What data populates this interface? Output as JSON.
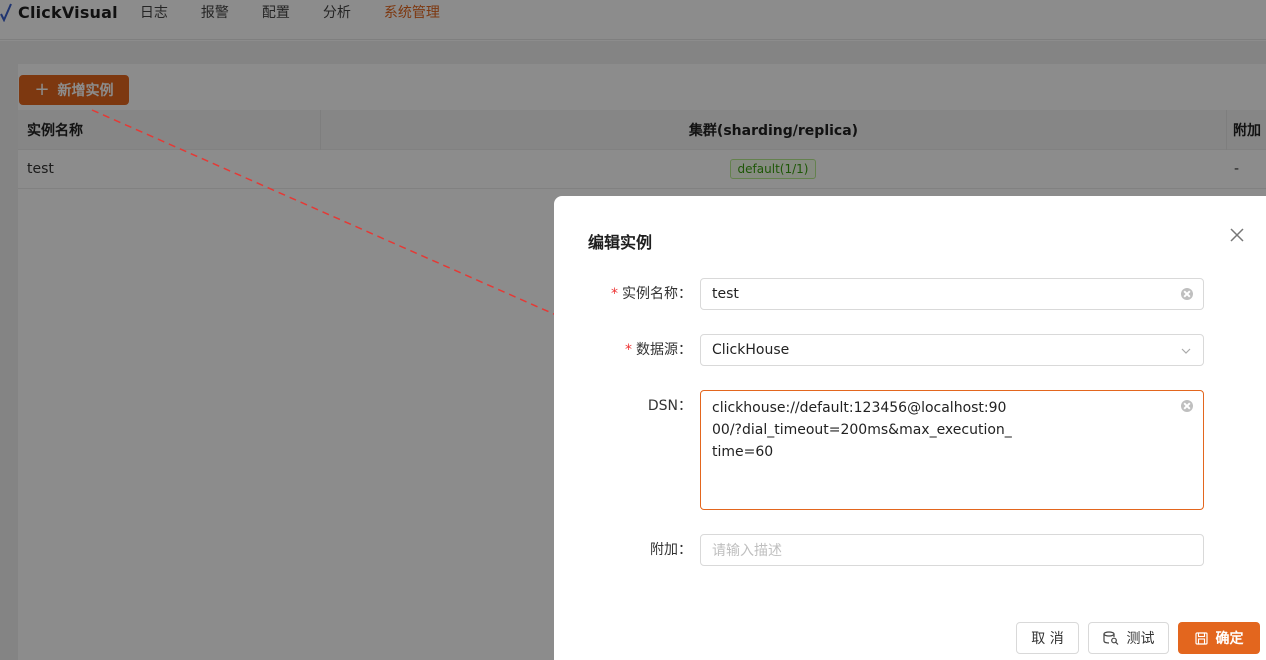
{
  "app": {
    "name": "ClickVisual"
  },
  "nav": [
    {
      "label": "日志",
      "active": false
    },
    {
      "label": "报警",
      "active": false
    },
    {
      "label": "配置",
      "active": false
    },
    {
      "label": "分析",
      "active": false
    },
    {
      "label": "系统管理",
      "active": true
    }
  ],
  "toolbar": {
    "add_label": "新增实例"
  },
  "table": {
    "columns": [
      "实例名称",
      "集群(sharding/replica)",
      "附加"
    ],
    "rows": [
      {
        "name": "test",
        "cluster": "default(1/1)",
        "extra": "-"
      }
    ]
  },
  "drawer": {
    "title": "编辑实例",
    "fields": {
      "name": {
        "label": "实例名称",
        "required": true,
        "value": "test"
      },
      "datasource": {
        "label": "数据源",
        "required": true,
        "value": "ClickHouse"
      },
      "dsn": {
        "label": "DSN",
        "required": false,
        "value": "clickhouse://default:123456@localhost:9000/?dial_timeout=200ms&max_execution_time=60"
      },
      "extra": {
        "label": "附加",
        "required": false,
        "placeholder": "请输入描述"
      }
    },
    "buttons": {
      "cancel": "取 消",
      "test": "测试",
      "ok": "确定"
    }
  },
  "colors": {
    "accent": "#e3661e",
    "tag_bg": "#f6ffed",
    "tag_text": "#389e0d",
    "required": "#ee3333",
    "annotation": "#e53935"
  }
}
